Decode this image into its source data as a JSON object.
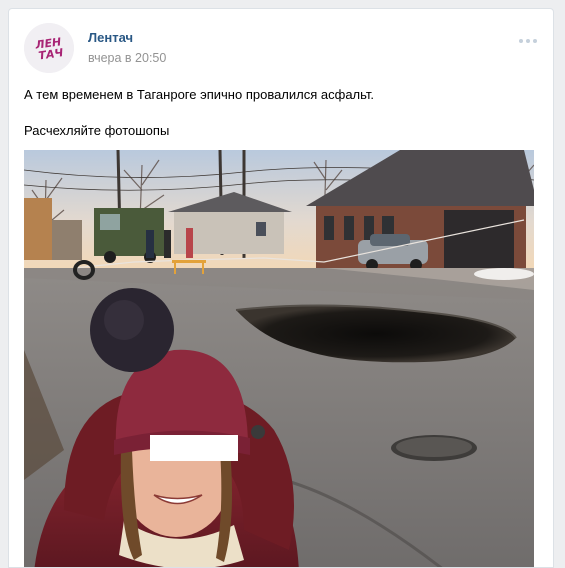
{
  "post": {
    "author": "Лентач",
    "time": "вчера в 20:50",
    "avatar_logo": "ЛЕНТАЧ",
    "text_line_1": "А тем временем в Таганроге эпично провалился асфальт.",
    "text_line_2": "Расчехляйте фотошопы",
    "more_icon": "more-horizontal-icon"
  },
  "colors": {
    "author": "#2a5885",
    "time": "#939393",
    "brand": "#a82575"
  }
}
